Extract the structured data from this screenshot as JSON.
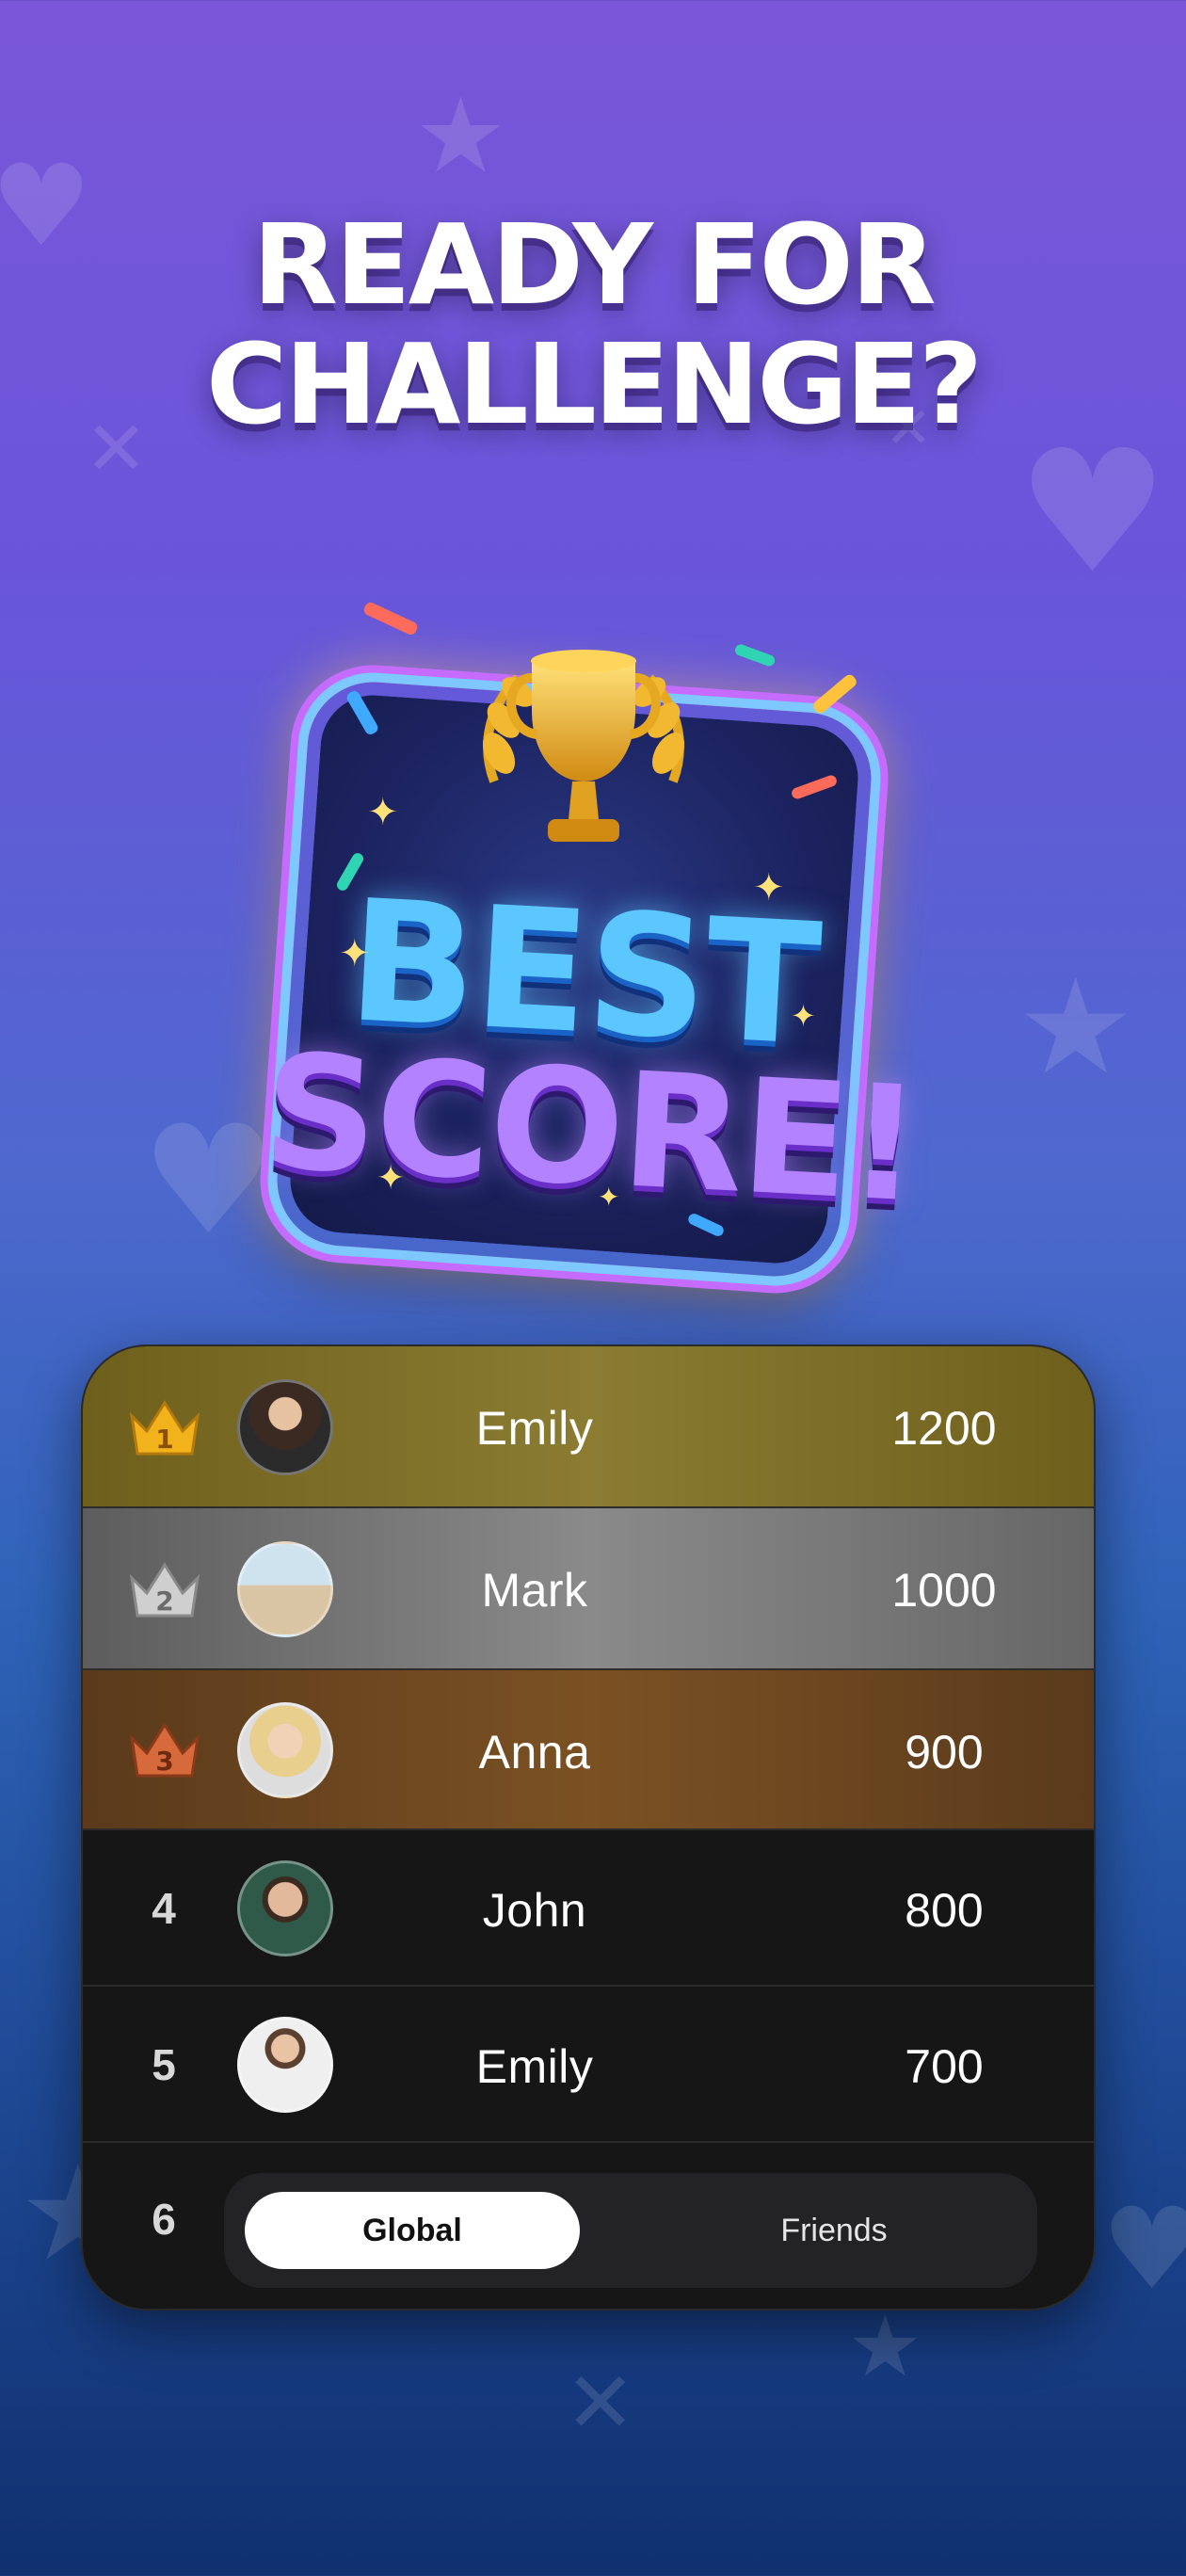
{
  "headline": {
    "line1": "READY FOR",
    "line2": "CHALLENGE?"
  },
  "badge": {
    "line1": "BEST",
    "line2": "SCORE!"
  },
  "leaderboard": {
    "rows": [
      {
        "rank": "1",
        "name": "Emily",
        "score": "1200",
        "medal": "gold"
      },
      {
        "rank": "2",
        "name": "Mark",
        "score": "1000",
        "medal": "silver"
      },
      {
        "rank": "3",
        "name": "Anna",
        "score": "900",
        "medal": "bronze"
      },
      {
        "rank": "4",
        "name": "John",
        "score": "800"
      },
      {
        "rank": "5",
        "name": "Emily",
        "score": "700"
      },
      {
        "rank": "6"
      }
    ]
  },
  "scope_toggle": {
    "selected": "Global",
    "options": [
      "Global",
      "Friends"
    ]
  },
  "colors": {
    "gold": "#d9a21f",
    "silver": "#bdbdbd",
    "bronze": "#c96a3a",
    "accent_blue": "#5cc7ff",
    "accent_purple": "#b383ff"
  }
}
